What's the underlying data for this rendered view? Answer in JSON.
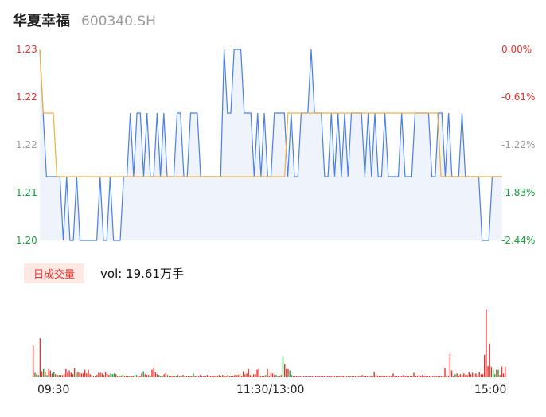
{
  "header": {
    "stock_name": "华夏幸福",
    "stock_code": "600340.SH"
  },
  "volume_panel": {
    "tab_label": "日成交量",
    "vol_label": "vol: 19.61万手"
  },
  "colors": {
    "up": "#e8322d",
    "down": "#13a33a",
    "flat": "#999999",
    "price_line": "#4a7fe6",
    "avg_line": "#f0b13c",
    "fill": "#eef3fc"
  },
  "chart_data": [
    {
      "type": "line",
      "title": "",
      "y_left_ticks": [
        "1.23",
        "1.22",
        "1.22",
        "1.21",
        "1.20"
      ],
      "y_right_ticks": [
        "0.00%",
        "-0.61%",
        "-1.22%",
        "-1.83%",
        "-2.44%"
      ],
      "ylim": [
        1.2,
        1.23
      ],
      "x_ticks": [
        "09:30",
        "11:30/13:00",
        "15:00"
      ],
      "series": [
        {
          "values": [
            1.23,
            1.22,
            1.21,
            1.21,
            1.21,
            1.21,
            1.21,
            1.2,
            1.21,
            1.2,
            1.2,
            1.21,
            1.2,
            1.2,
            1.2,
            1.2,
            1.2,
            1.2,
            1.21,
            1.2,
            1.2,
            1.21,
            1.2,
            1.2,
            1.2,
            1.21,
            1.21,
            1.22,
            1.21,
            1.22,
            1.22,
            1.21,
            1.22,
            1.21,
            1.21,
            1.22,
            1.21,
            1.22,
            1.21,
            1.21,
            1.21,
            1.22,
            1.22,
            1.21,
            1.21,
            1.22,
            1.22,
            1.22,
            1.21,
            1.21,
            1.21,
            1.21,
            1.21,
            1.21,
            1.21,
            1.23,
            1.22,
            1.22,
            1.23,
            1.23,
            1.23,
            1.22,
            1.22,
            1.22,
            1.21,
            1.22,
            1.21,
            1.22,
            1.21,
            1.21,
            1.22,
            1.22,
            1.22,
            1.22,
            1.21,
            1.22,
            1.21,
            1.21,
            1.22,
            1.22,
            1.22,
            1.23,
            1.22,
            1.22,
            1.22,
            1.21,
            1.21,
            1.22,
            1.21,
            1.22,
            1.21,
            1.22,
            1.21,
            1.22,
            1.22,
            1.22,
            1.22,
            1.21,
            1.22,
            1.21,
            1.22,
            1.21,
            1.21,
            1.22,
            1.21,
            1.21,
            1.21,
            1.21,
            1.22,
            1.21,
            1.21,
            1.21,
            1.22,
            1.22,
            1.22,
            1.22,
            1.22,
            1.21,
            1.21,
            1.22,
            1.22,
            1.21,
            1.22,
            1.21,
            1.21,
            1.21,
            1.22,
            1.21,
            1.21,
            1.21,
            1.21,
            1.21,
            1.2,
            1.2,
            1.2,
            1.21,
            1.21,
            1.21,
            1.21
          ]
        },
        {
          "values": [
            1.23,
            1.22,
            1.22,
            1.22,
            1.22,
            1.21,
            1.21,
            1.21,
            1.21,
            1.21,
            1.21,
            1.21,
            1.21,
            1.21,
            1.21,
            1.21,
            1.21,
            1.21,
            1.21,
            1.21,
            1.21,
            1.21,
            1.21,
            1.21,
            1.21,
            1.21,
            1.21,
            1.21,
            1.21,
            1.21,
            1.21,
            1.21,
            1.21,
            1.21,
            1.21,
            1.21,
            1.21,
            1.21,
            1.21,
            1.21,
            1.21,
            1.21,
            1.21,
            1.21,
            1.21,
            1.21,
            1.21,
            1.21,
            1.21,
            1.21,
            1.21,
            1.21,
            1.21,
            1.21,
            1.21,
            1.21,
            1.21,
            1.21,
            1.21,
            1.21,
            1.21,
            1.21,
            1.21,
            1.21,
            1.21,
            1.21,
            1.21,
            1.21,
            1.21,
            1.21,
            1.21,
            1.21,
            1.21,
            1.22,
            1.22,
            1.22,
            1.22,
            1.22,
            1.22,
            1.22,
            1.22,
            1.22,
            1.22,
            1.22,
            1.22,
            1.22,
            1.22,
            1.22,
            1.22,
            1.22,
            1.22,
            1.22,
            1.22,
            1.22,
            1.22,
            1.22,
            1.22,
            1.22,
            1.22,
            1.22,
            1.22,
            1.22,
            1.22,
            1.22,
            1.22,
            1.22,
            1.22,
            1.22,
            1.22,
            1.22,
            1.22,
            1.22,
            1.22,
            1.22,
            1.22,
            1.22,
            1.22,
            1.22,
            1.21,
            1.21,
            1.21,
            1.21,
            1.21,
            1.21,
            1.21,
            1.21,
            1.21,
            1.21,
            1.21,
            1.21,
            1.21,
            1.21,
            1.21,
            1.21,
            1.21,
            1.21,
            1.21
          ]
        }
      ]
    },
    {
      "type": "bar",
      "title": "",
      "x_ticks": [
        "09:30",
        "11:30/13:00",
        "15:00"
      ],
      "values": [
        0.42,
        0.06,
        0.04,
        0.03,
        0.52,
        0.08,
        0.11,
        0.07,
        0.03,
        0.11,
        0.09,
        0.05,
        0.07,
        0.04,
        0.03,
        0.03,
        0.03,
        0.03,
        0.04,
        0.11,
        0.06,
        0.09,
        0.06,
        0.04,
        0.12,
        0.06,
        0.07,
        0.06,
        0.05,
        0.05,
        0.1,
        0.05,
        0.1,
        0.04,
        0.03,
        0.02,
        0.02,
        0.03,
        0.06,
        0.06,
        0.05,
        0.03,
        0.07,
        0.04,
        0.03,
        0.05,
        0.04,
        0.05,
        0.04,
        0.02,
        0.02,
        0.02,
        0.03,
        0.02,
        0.02,
        0.02,
        0.01,
        0.02,
        0.02,
        0.03,
        0.03,
        0.02,
        0.02,
        0.05,
        0.08,
        0.04,
        0.03,
        0.03,
        0.02,
        0.1,
        0.13,
        0.07,
        0.04,
        0.03,
        0.02,
        0.02,
        0.04,
        0.06,
        0.03,
        0.02,
        0.02,
        0.02,
        0.02,
        0.02,
        0.03,
        0.02,
        0.01,
        0.03,
        0.02,
        0.02,
        0.02,
        0.01,
        0.02,
        0.05,
        0.02,
        0.01,
        0.02,
        0.03,
        0.01,
        0.02,
        0.02,
        0.03,
        0.01,
        0.02,
        0.02,
        0.01,
        0.02,
        0.02,
        0.03,
        0.02,
        0.03,
        0.02,
        0.02,
        0.03,
        0.01,
        0.02,
        0.02,
        0.03,
        0.03,
        0.03,
        0.04,
        0.02,
        0.08,
        0.04,
        0.05,
        0.11,
        0.03,
        0.02,
        0.04,
        0.04,
        0.1,
        0.11,
        0.02,
        0.02,
        0.02,
        0.03,
        0.11,
        0.02,
        0.06,
        0.05,
        0.03,
        0.03,
        0.01,
        0.02,
        0.03,
        0.28,
        0.17,
        0.11,
        0.11,
        0.09,
        0.03,
        0.02,
        0.01,
        0.02,
        0.01,
        0.01,
        0.01,
        0.01,
        0.01,
        0.01,
        0.01,
        0.01,
        0.02,
        0.01,
        0.02,
        0.01,
        0.01,
        0.01,
        0.01,
        0.02,
        0.01,
        0.01,
        0.01,
        0.02,
        0.02,
        0.01,
        0.01,
        0.02,
        0.01,
        0.02,
        0.02,
        0.02,
        0.01,
        0.01,
        0.01,
        0.02,
        0.02,
        0.01,
        0.01,
        0.02,
        0.01,
        0.03,
        0.01,
        0.02,
        0.01,
        0.02,
        0.01,
        0.02,
        0.07,
        0.03,
        0.02,
        0.02,
        0.02,
        0.02,
        0.02,
        0.02,
        0.02,
        0.01,
        0.02,
        0.05,
        0.02,
        0.02,
        0.02,
        0.02,
        0.02,
        0.03,
        0.02,
        0.02,
        0.02,
        0.02,
        0.02,
        0.06,
        0.02,
        0.02,
        0.03,
        0.02,
        0.03,
        0.02,
        0.02,
        0.02,
        0.02,
        0.02,
        0.02,
        0.02,
        0.02,
        0.02,
        0.02,
        0.02,
        0.02,
        0.12,
        0.02,
        0.02,
        0.31,
        0.09,
        0.02,
        0.04,
        0.05,
        0.02,
        0.04,
        0.03,
        0.05,
        0.03,
        0.03,
        0.07,
        0.04,
        0.06,
        0.04,
        0.05,
        0.02,
        0.07,
        0.04,
        0.04,
        0.3,
        0.91,
        0.15,
        0.45,
        0.14,
        0.1,
        0.04,
        0.1,
        0.1,
        0.03,
        0.14,
        0.05,
        0.14
      ],
      "directions": [
        "up",
        "down",
        "up",
        "down",
        "up",
        "up",
        "down",
        "up",
        "down",
        "up",
        "up",
        "up",
        "down",
        "up",
        "up",
        "down",
        "up",
        "up",
        "up",
        "up",
        "up",
        "up",
        "up",
        "up",
        "up",
        "down",
        "up",
        "up",
        "up",
        "up",
        "up",
        "up",
        "up",
        "up",
        "up",
        "down",
        "up",
        "up",
        "up",
        "up",
        "up",
        "up",
        "up",
        "up",
        "up",
        "down",
        "down",
        "down",
        "up",
        "up",
        "down",
        "up",
        "down",
        "up",
        "up",
        "up",
        "down",
        "up",
        "up",
        "down",
        "down",
        "up",
        "up",
        "up",
        "down",
        "up",
        "up",
        "up",
        "down",
        "up",
        "up",
        "up",
        "up",
        "down",
        "up",
        "down",
        "up",
        "up",
        "down",
        "up",
        "up",
        "up",
        "up",
        "down",
        "up",
        "up",
        "down",
        "up",
        "up",
        "down",
        "up",
        "up",
        "up",
        "down",
        "up",
        "up",
        "up",
        "up",
        "up",
        "up",
        "up",
        "up",
        "up",
        "up",
        "up",
        "up",
        "up",
        "up",
        "up",
        "up",
        "up",
        "up",
        "up",
        "up",
        "up",
        "up",
        "up",
        "up",
        "up",
        "up",
        "up",
        "up",
        "up",
        "up",
        "up",
        "up",
        "up",
        "up",
        "up",
        "up",
        "up",
        "up",
        "up",
        "up",
        "up",
        "down",
        "up",
        "up",
        "up",
        "up",
        "up",
        "down",
        "up",
        "up",
        "up",
        "down",
        "up",
        "up",
        "up",
        "down",
        "down",
        "up",
        "up",
        "up",
        "up",
        "up",
        "up",
        "up",
        "up",
        "up",
        "up",
        "up",
        "up",
        "up",
        "up",
        "up",
        "up",
        "up",
        "up",
        "up",
        "up",
        "up",
        "up",
        "up",
        "up",
        "up",
        "up",
        "up",
        "up",
        "up",
        "up",
        "up",
        "up",
        "up",
        "up",
        "up",
        "up",
        "up",
        "up",
        "up",
        "up",
        "up",
        "up",
        "up",
        "up",
        "up",
        "up",
        "up",
        "up",
        "up",
        "up",
        "up",
        "up",
        "up",
        "up",
        "up",
        "up",
        "up",
        "up",
        "up",
        "up",
        "up",
        "up",
        "up",
        "up",
        "up",
        "up",
        "up",
        "up",
        "up",
        "up",
        "up",
        "up",
        "up",
        "up",
        "up",
        "up",
        "up",
        "up",
        "up",
        "up",
        "up",
        "up",
        "up",
        "up",
        "up",
        "up",
        "up",
        "up",
        "up",
        "up",
        "up",
        "up",
        "up",
        "up",
        "down",
        "up",
        "up",
        "up",
        "up",
        "up",
        "up",
        "up",
        "up",
        "up",
        "up",
        "up",
        "up",
        "up",
        "up",
        "up",
        "up",
        "up",
        "up",
        "up",
        "up",
        "up",
        "down",
        "down",
        "up",
        "down",
        "up",
        "up",
        "up",
        "up",
        "up",
        "up",
        "up",
        "up",
        "up"
      ]
    }
  ]
}
